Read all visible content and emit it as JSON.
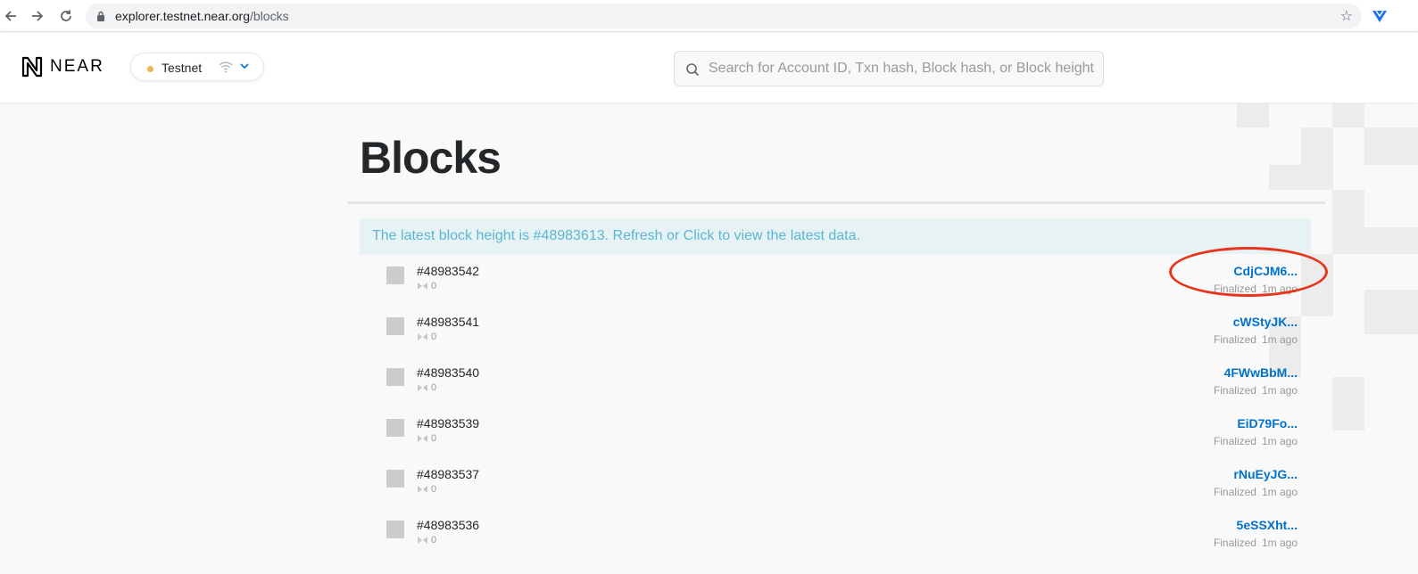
{
  "browser": {
    "url_host": "explorer.testnet.near.org",
    "url_path": "/blocks"
  },
  "header": {
    "logo_text": "NEAR",
    "network": {
      "label": "Testnet",
      "status_color": "#f0b256"
    },
    "search": {
      "placeholder": "Search for Account ID, Txn hash, Block hash, or Block height"
    }
  },
  "main": {
    "title": "Blocks",
    "update_banner": "The latest block height is #48983613. Refresh or Click to view the latest data.",
    "blocks": [
      {
        "height": "#48983542",
        "tx_count": "0",
        "hash": "CdjCJM6...",
        "status": "Finalized",
        "age": "1m ago"
      },
      {
        "height": "#48983541",
        "tx_count": "0",
        "hash": "cWStyJK...",
        "status": "Finalized",
        "age": "1m ago"
      },
      {
        "height": "#48983540",
        "tx_count": "0",
        "hash": "4FWwBbM...",
        "status": "Finalized",
        "age": "1m ago"
      },
      {
        "height": "#48983539",
        "tx_count": "0",
        "hash": "EiD79Fo...",
        "status": "Finalized",
        "age": "1m ago"
      },
      {
        "height": "#48983537",
        "tx_count": "0",
        "hash": "rNuEyJG...",
        "status": "Finalized",
        "age": "1m ago"
      },
      {
        "height": "#48983536",
        "tx_count": "0",
        "hash": "5eSSXht...",
        "status": "Finalized",
        "age": "1m ago"
      }
    ]
  },
  "colors": {
    "accent_link": "#0072ce",
    "banner_text": "#5cb6d4",
    "annotation": "#e8341c"
  }
}
